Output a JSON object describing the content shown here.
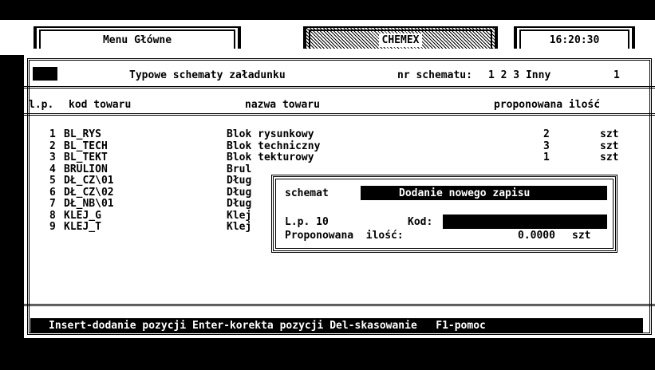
{
  "header": {
    "menu_tab": "Menu Główne",
    "app_tab": "CHEMEX",
    "clock": "16:20:30"
  },
  "screen": {
    "title": "Typowe schematy załadunku",
    "scheme_label": "nr schematu:",
    "scheme_options": "1 2 3 Inny",
    "scheme_current": "1"
  },
  "table": {
    "columns": {
      "lp": "l.p.",
      "code": "kod towaru",
      "name": "nazwa towaru",
      "qty": "proponowana ilość"
    },
    "rows": [
      {
        "lp": "1",
        "code": "BL_RYS",
        "name": "Blok rysunkowy",
        "qty": "2",
        "unit": "szt"
      },
      {
        "lp": "2",
        "code": "BL_TECH",
        "name": "Blok techniczny",
        "qty": "3",
        "unit": "szt"
      },
      {
        "lp": "3",
        "code": "BL_TEKT",
        "name": "Blok tekturowy",
        "qty": "1",
        "unit": "szt"
      },
      {
        "lp": "4",
        "code": "BRULION",
        "name": "Brul",
        "qty": "",
        "unit": ""
      },
      {
        "lp": "5",
        "code": "DŁ_CZ\\01",
        "name": "Dług",
        "qty": "",
        "unit": ""
      },
      {
        "lp": "6",
        "code": "DŁ_CZ\\02",
        "name": "Dług",
        "qty": "",
        "unit": ""
      },
      {
        "lp": "7",
        "code": "DŁ_NB\\01",
        "name": "Dług",
        "qty": "",
        "unit": ""
      },
      {
        "lp": "8",
        "code": "KLEJ_G",
        "name": "Klej",
        "qty": "",
        "unit": ""
      },
      {
        "lp": "9",
        "code": "KLEJ_T",
        "name": "Klej",
        "qty": "",
        "unit": ""
      }
    ]
  },
  "dialog": {
    "schema_label": "schemat",
    "mode": "Dodanie nowego zapisu",
    "lp_label": "L.p. 10",
    "code_label": "Kod:",
    "code_value": "",
    "qty_label": "Proponowana  ilość:",
    "qty_value": "0.0000",
    "qty_unit": "szt"
  },
  "status_bar": "Insert-dodanie pozycji Enter-korekta pozycji Del-skasowanie   F1-pomoc",
  "colors": {
    "background": "#000000",
    "panel": "#ffffff",
    "text": "#000000"
  }
}
